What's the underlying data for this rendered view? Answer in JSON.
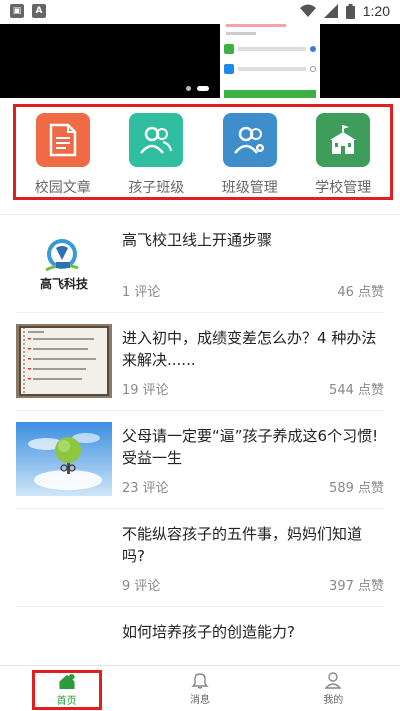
{
  "status_bar": {
    "time": "1:20",
    "left_icons": [
      "app-notification-icon",
      "font-notification-icon"
    ],
    "right_icons": [
      "wifi-icon",
      "signal-icon",
      "battery-icon"
    ]
  },
  "banner": {
    "slide_count": 2,
    "active_slide": 2
  },
  "quick_menu": [
    {
      "label": "校园文章",
      "icon": "document-icon",
      "color": "#ef6a45"
    },
    {
      "label": "孩子班级",
      "icon": "people-icon",
      "color": "#2fbfa0"
    },
    {
      "label": "班级管理",
      "icon": "class-manage-icon",
      "color": "#3e8ecb"
    },
    {
      "label": "学校管理",
      "icon": "school-building-icon",
      "color": "#3e9d5a"
    }
  ],
  "articles": [
    {
      "title": "高飞校卫线上开通步骤",
      "comments": "1 评论",
      "likes": "46 点赞",
      "thumb": "gaofei-logo"
    },
    {
      "title": "进入初中，成绩变差怎么办？4 种办法来解决......",
      "comments": "19 评论",
      "likes": "544 点赞",
      "thumb": "handwritten-notebook"
    },
    {
      "title": "父母请一定要“逼”孩子养成这6个习惯!受益一生",
      "comments": "23 评论",
      "likes": "589 点赞",
      "thumb": "tree-sky"
    },
    {
      "title": "不能纵容孩子的五件事，妈妈们知道吗?",
      "comments": "9 评论",
      "likes": "397 点赞",
      "thumb": ""
    },
    {
      "title": "如何培养孩子的创造能力?",
      "comments": "",
      "likes": "",
      "thumb": ""
    }
  ],
  "logo": {
    "text": "高飞科技"
  },
  "tabs": [
    {
      "label": "首页",
      "icon": "home-icon",
      "active": true
    },
    {
      "label": "消息",
      "icon": "bell-icon",
      "active": false
    },
    {
      "label": "我的",
      "icon": "person-icon",
      "active": false
    }
  ],
  "colors": {
    "accent_green": "#2a9d3a",
    "highlight_red": "#e02020"
  }
}
